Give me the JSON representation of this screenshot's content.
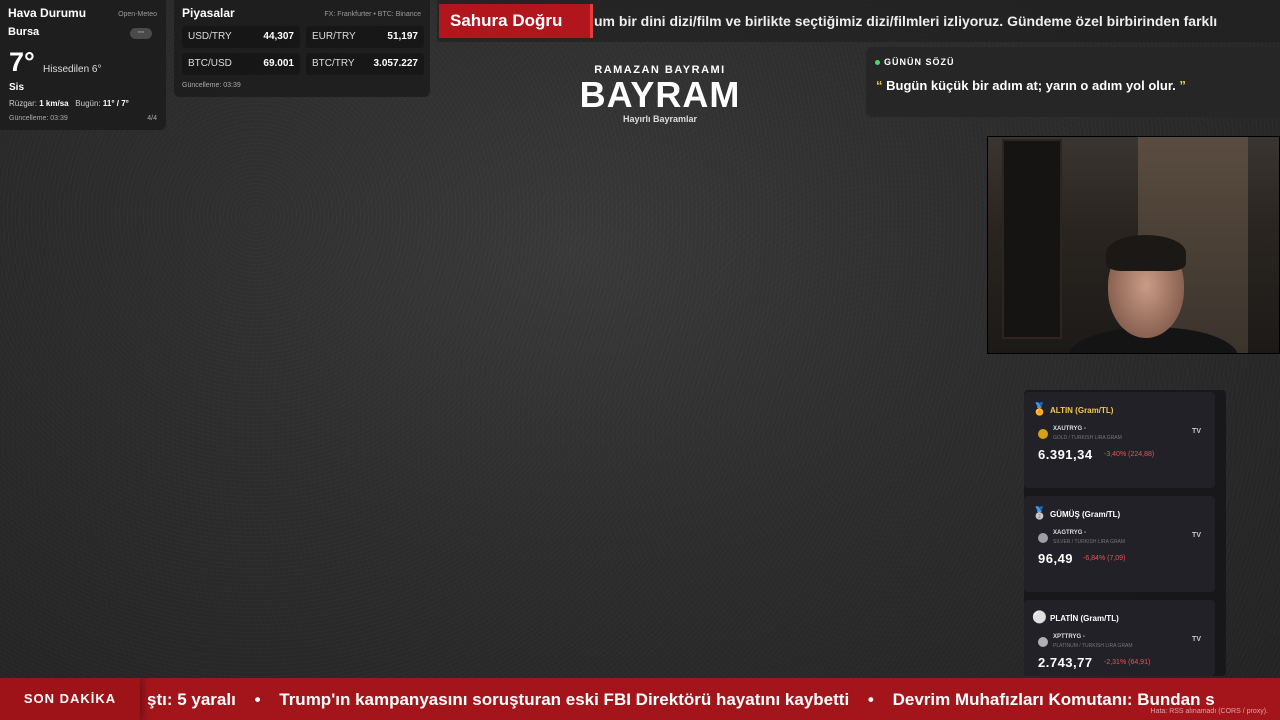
{
  "weather": {
    "title": "Hava Durumu",
    "source": "Open-Meteo",
    "city": "Bursa",
    "icon_label": "≈≈",
    "temp": "7°",
    "feels": "Hissedilen 6°",
    "condition": "Sis",
    "wind_label": "Rüzgar:",
    "wind_value": "1 km/sa",
    "today_label": "Bugün:",
    "today_value": "11° / 7°",
    "updated": "Güncelleme: 03:39",
    "page": "4/4"
  },
  "markets": {
    "title": "Piyasalar",
    "source": "FX: Frankfurter • BTC: Binance",
    "items": [
      {
        "name": "USD/TRY",
        "value": "44,307"
      },
      {
        "name": "EUR/TRY",
        "value": "51,197"
      },
      {
        "name": "BTC/USD",
        "value": "69.001"
      },
      {
        "name": "BTC/TRY",
        "value": "3.057.227"
      }
    ],
    "updated": "Güncelleme: 03:39"
  },
  "top_ticker": {
    "badge": "Sahura Doğru",
    "text": "um bir dini dizi/film ve birlikte seçtiğimiz dizi/filmleri izliyoruz. Gündeme özel birbirinden farklı"
  },
  "center": {
    "small": "RAMAZAN BAYRAMI",
    "big": "BAYRAM",
    "sub": "Hayırlı Bayramlar"
  },
  "quote": {
    "heading": "GÜNÜN SÖZÜ",
    "open_mark": "“",
    "text": "Bugün küçük bir adım at; yarın o adım yol olur.",
    "close_mark": "”",
    "dot_color": "#4cd964"
  },
  "metals": [
    {
      "label": "ALTIN (Gram/TL)",
      "label_color": "#f2c94c",
      "medal": "🏅",
      "symbol": "XAUTRYG ▫",
      "desc": "GOLD / TURKISH LIRA GRAM",
      "coin_color": "#d4a017",
      "tv": "TV",
      "price": "6.391,34",
      "change": "-3,40% (224,88)"
    },
    {
      "label": "GÜMÜŞ (Gram/TL)",
      "label_color": "#ffffff",
      "medal": "🥈",
      "symbol": "XAGTRYG ▫",
      "desc": "SILVER / TURKISH LIRA GRAM",
      "coin_color": "#9aa0a6",
      "tv": "TV",
      "price": "96,49",
      "change": "-6,84% (7,09)"
    },
    {
      "label": "PLATİN (Gram/TL)",
      "label_color": "#ffffff",
      "medal": "⚪",
      "symbol": "XPTTRYG ▫",
      "desc": "PLATINUM / TURKISH LIRA GRAM",
      "coin_color": "#b0b0b0",
      "tv": "TV",
      "price": "2.743,77",
      "change": "-2,31% (64,91)"
    }
  ],
  "bottom_ticker": {
    "badge": "SON DAKİKA",
    "items": [
      "ştı: 5 yaralı",
      "Trump'ın kampanyasını soruşturan eski FBI Direktörü hayatını kaybetti",
      "Devrim Muhafızları Komutanı: Bundan s"
    ],
    "separator": "•",
    "error": "Hata: RSS alınamadı (CORS / proxy)."
  }
}
